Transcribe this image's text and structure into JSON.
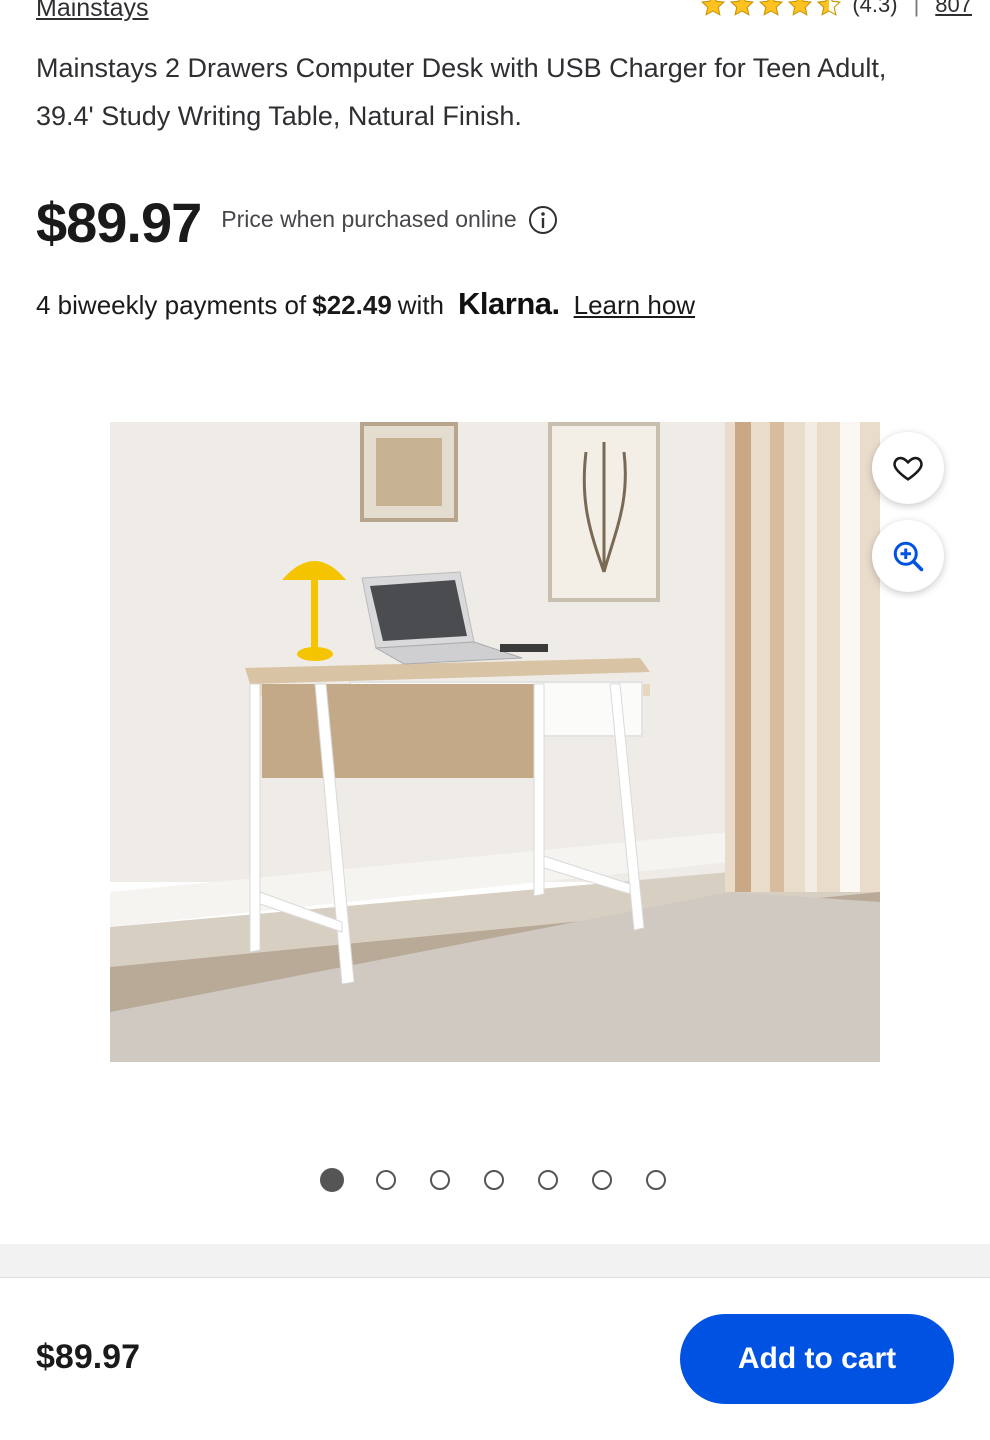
{
  "brand": "Mainstays",
  "rating": {
    "value_text": "(4.3)",
    "separator": "|",
    "review_count": "807",
    "stars_full": 4,
    "star_color": "#ffc220"
  },
  "product": {
    "title": "Mainstays 2 Drawers Computer Desk with USB Charger for Teen Adult, 39.4' Study Writing Table, Natural Finish."
  },
  "price": {
    "main": "$89.97",
    "note": "Price when purchased online"
  },
  "klarna": {
    "prefix": "4 biweekly payments of",
    "amount": "$22.49",
    "with": "with",
    "logo": "Klarna.",
    "learn_how": "Learn how"
  },
  "carousel": {
    "total": 7,
    "active_index": 0
  },
  "icons": {
    "favorite": "heart-icon",
    "zoom": "zoom-in-icon",
    "info": "info-icon"
  },
  "footer": {
    "price": "$89.97",
    "add_to_cart": "Add to cart"
  },
  "colors": {
    "accent": "#0053e2",
    "star": "#ffc220"
  }
}
